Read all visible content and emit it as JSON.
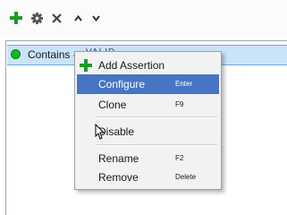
{
  "toolbar": {
    "buttons": [
      {
        "icon": "plus-icon",
        "color": "#1f9a2a"
      },
      {
        "icon": "gear-icon",
        "color": "#555555"
      },
      {
        "icon": "close-icon",
        "color": "#444444"
      },
      {
        "icon": "chevron-up-icon",
        "color": "#333333"
      },
      {
        "icon": "chevron-down-icon",
        "color": "#333333"
      }
    ]
  },
  "assertion_row": {
    "status_color": "#10b81d",
    "label": "Contains - ",
    "label_tail": "VALID"
  },
  "context_menu": {
    "items": [
      {
        "label": "Add Assertion",
        "shortcut": "",
        "icon": "plus-icon"
      },
      {
        "label": "Configure",
        "shortcut": "Enter"
      },
      {
        "label": "Clone",
        "shortcut": "F9"
      },
      {
        "label": "Disable",
        "shortcut": ""
      },
      {
        "label": "Rename",
        "shortcut": "F2"
      },
      {
        "label": "Remove",
        "shortcut": "Delete"
      }
    ],
    "selected_index": 1,
    "accent": "#4874c4"
  }
}
